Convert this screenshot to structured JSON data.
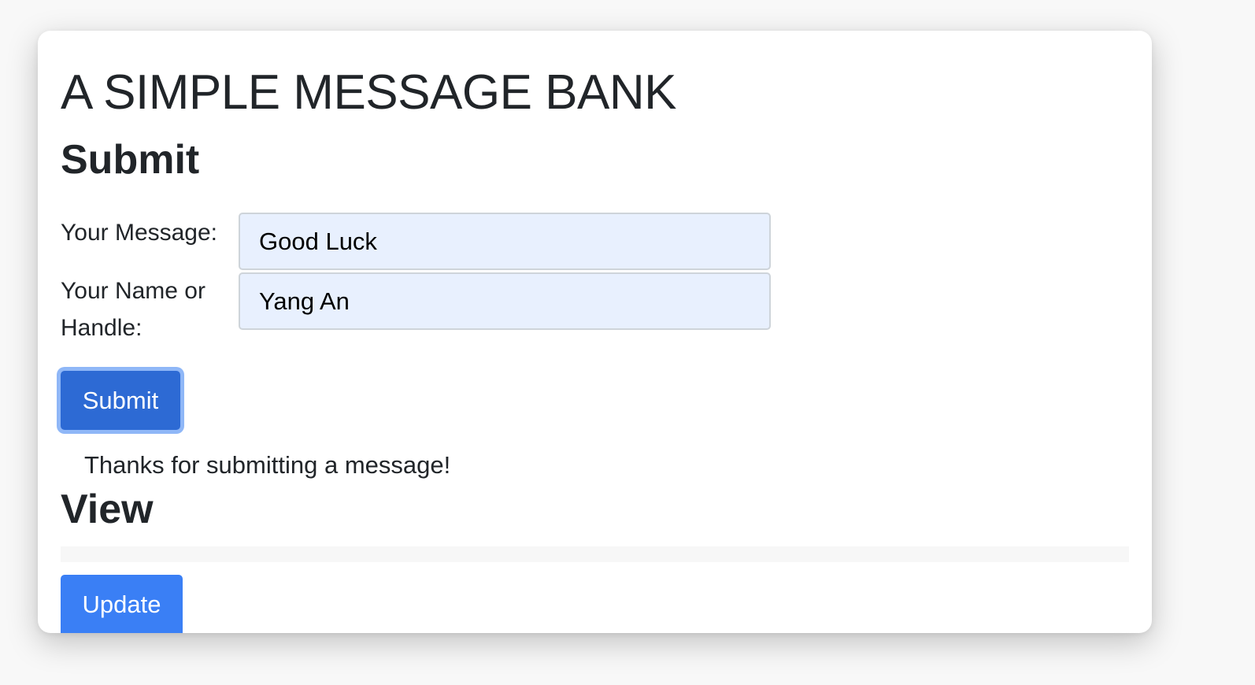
{
  "app": {
    "title": "A SIMPLE MESSAGE BANK"
  },
  "submit_section": {
    "heading": "Submit",
    "message_label": "Your Message:",
    "message_value": "Good Luck",
    "name_label": "Your Name or Handle:",
    "name_value": "Yang An",
    "submit_button_label": "Submit",
    "confirmation": "Thanks for submitting a message!"
  },
  "view_section": {
    "heading": "View",
    "update_button_label": "Update"
  },
  "colors": {
    "submit_button": "#2d6ad4",
    "submit_focus_ring": "#8fb7f7",
    "update_button": "#3a7ff5",
    "input_background": "#e8f0fe",
    "text": "#212529"
  }
}
